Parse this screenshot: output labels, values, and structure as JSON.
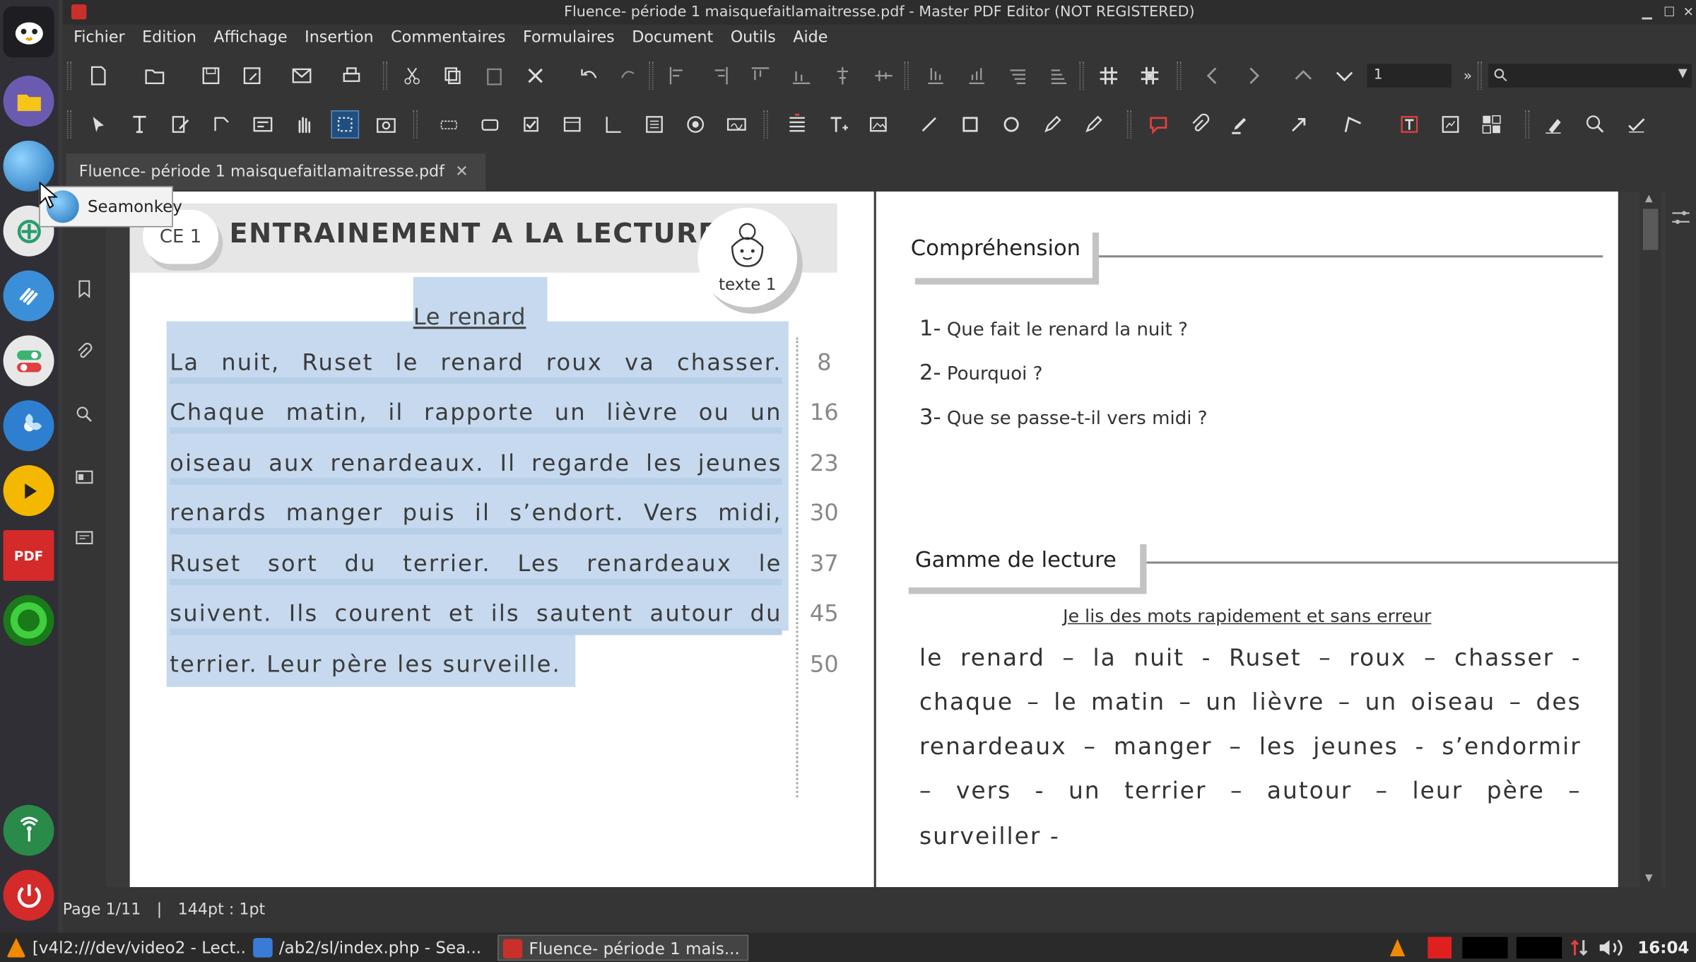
{
  "window": {
    "title": "Fluence- période 1 maisquefaitlamaitresse.pdf - Master PDF Editor (NOT REGISTERED)"
  },
  "menu": [
    "Fichier",
    "Edition",
    "Affichage",
    "Insertion",
    "Commentaires",
    "Formulaires",
    "Document",
    "Outils",
    "Aide"
  ],
  "toolbar": {
    "page_number": "1"
  },
  "tab": {
    "label": "Fluence- période 1 maisquefaitlamaitresse.pdf",
    "close": "✕"
  },
  "tooltip": {
    "label": "Seamonkey"
  },
  "left_page": {
    "level": "CE 1",
    "banner_title": "ENTRAINEMENT A LA LECTURE",
    "badge_label": "texte 1",
    "story_title": "Le renard",
    "lines": [
      "La nuit, Ruset le renard roux va chasser.",
      "Chaque matin, il rapporte un lièvre ou un",
      "oiseau aux renardeaux. Il regarde les jeunes",
      "renards manger puis il s’endort. Vers midi,",
      "Ruset sort du terrier. Les renardeaux le",
      "suivent. Ils courent et ils sautent autour du",
      "terrier. Leur père les surveille."
    ],
    "word_counts": [
      "8",
      "16",
      "23",
      "30",
      "37",
      "45",
      "50"
    ]
  },
  "right_page": {
    "comprehension_title": "Compréhension",
    "questions": [
      {
        "num": "1-",
        "text": "Que fait le renard la nuit ?"
      },
      {
        "num": "2-",
        "text": "Pourquoi ?"
      },
      {
        "num": "3-",
        "text": "Que se passe-t-il vers midi ?"
      }
    ],
    "gamme_title": "Gamme de lecture",
    "gamme_subtitle": "Je lis des mots rapidement et sans erreur",
    "gamme_lines": [
      "le renard – la nuit - Ruset – roux – chasser -",
      "chaque – le matin – un lièvre – un oiseau – des",
      "renardeaux – manger – les jeunes - s’endormir",
      "– vers - un terrier – autour – leur père –",
      "surveiller -"
    ]
  },
  "status": {
    "page": "Page 1/11",
    "sep": "|",
    "zoom": "144pt : 1pt"
  },
  "taskbar": {
    "tasks": [
      {
        "label": "[v4l2:///dev/video2 - Lect...",
        "icon_color": "#f08a00"
      },
      {
        "label": "/ab2/sl/index.php - Sea...",
        "icon_color": "#3a7bd5"
      },
      {
        "label": "Fluence- période 1 mais...",
        "icon_color": "#c9302c"
      }
    ],
    "clock": "16:04"
  }
}
